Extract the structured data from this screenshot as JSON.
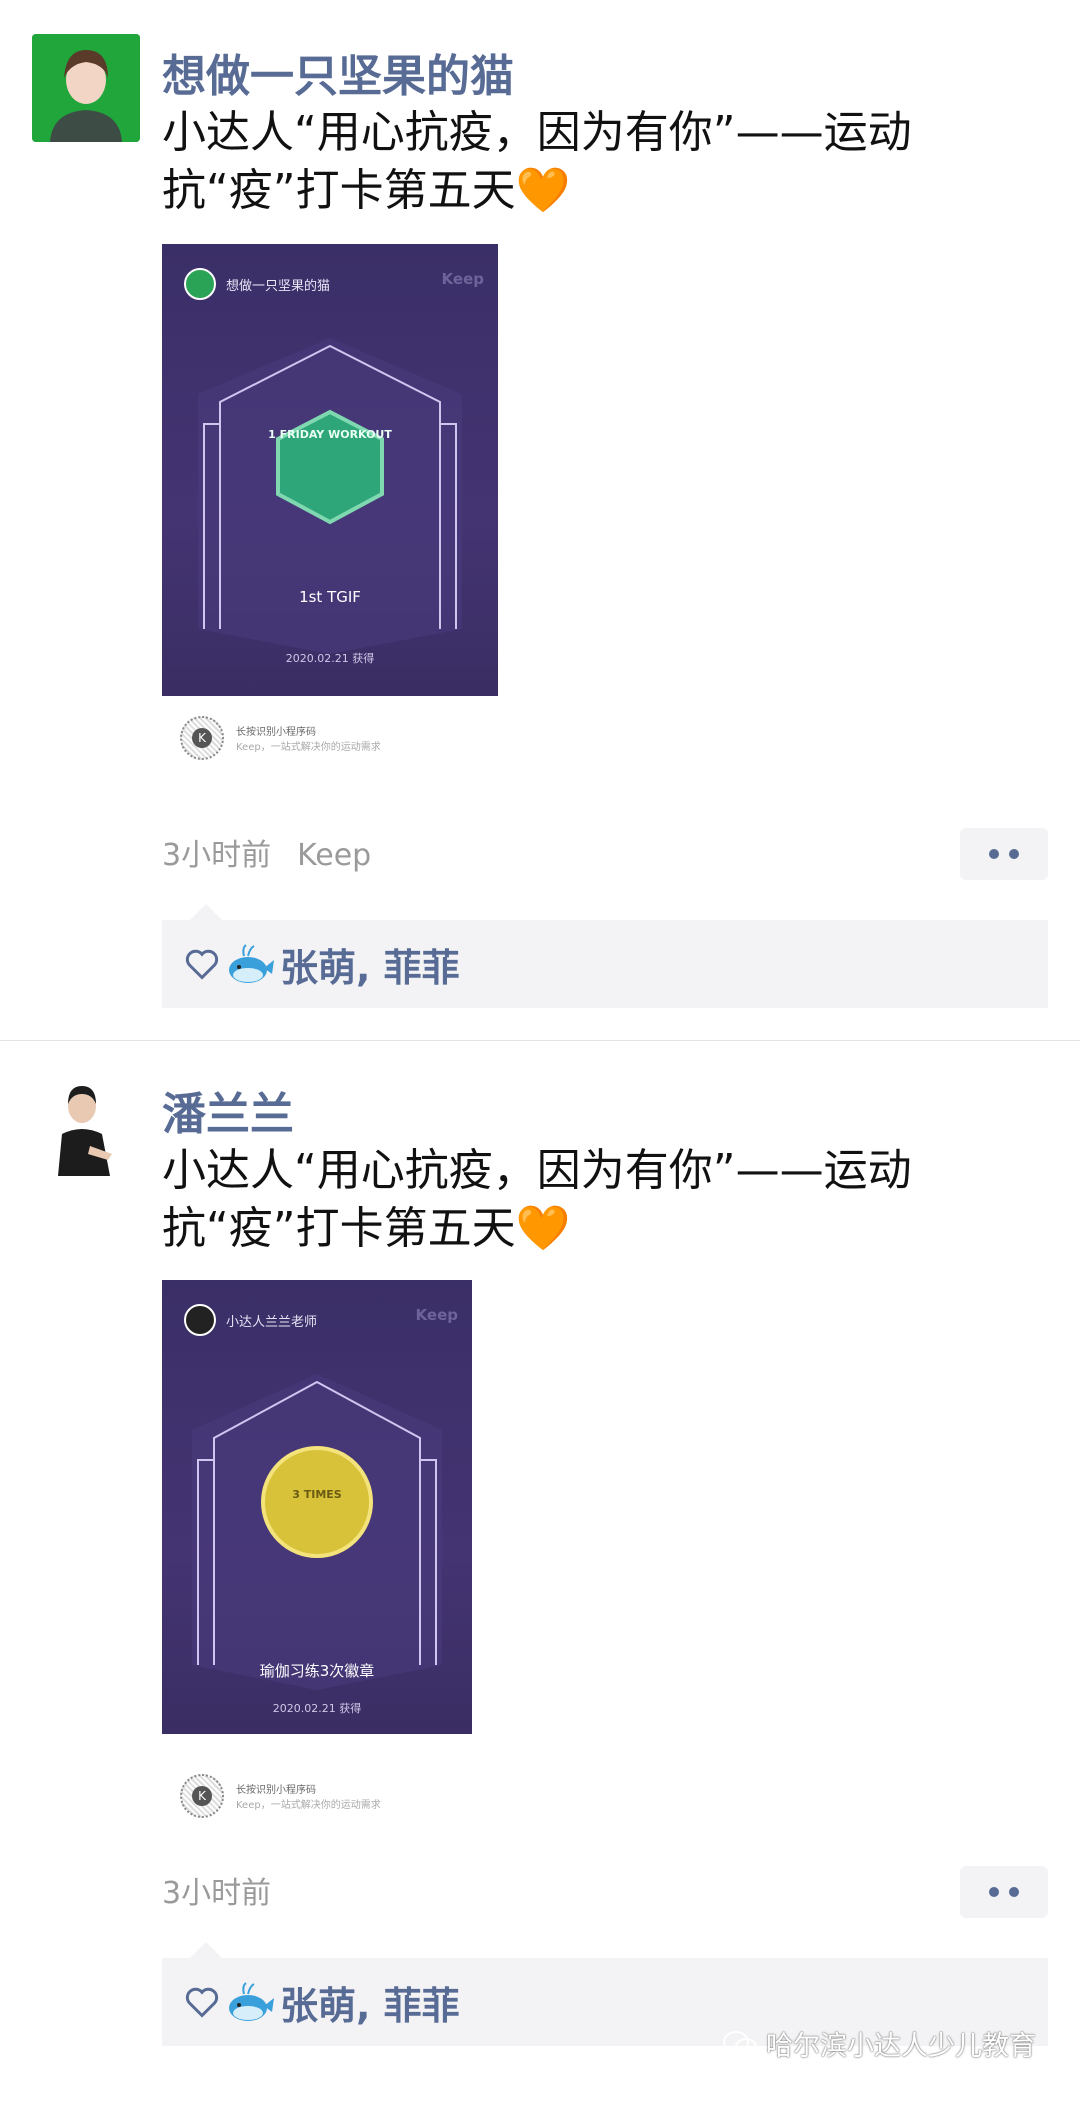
{
  "posts": [
    {
      "username": "想做一只坚果的猫",
      "content": "小达人“用心抗疫，因为有你”——运动抗“疫”打卡第五天",
      "emoji": "🧡",
      "card": {
        "poster_user": "想做一只坚果的猫",
        "brand": "Keep",
        "badge_title": "1st TGIF",
        "badge_date": "2020.02.21 获得",
        "badge_icon_text": "1 FRIDAY WORKOUT",
        "qr_line1": "长按识别小程序码",
        "qr_line2": "Keep，一站式解决你的运动需求"
      },
      "time": "3小时前",
      "source": "Keep",
      "likes": "张萌, 菲菲"
    },
    {
      "username": "潘兰兰",
      "content": "小达人“用心抗疫，因为有你”——运动抗“疫”打卡第五天",
      "emoji": "🧡",
      "card": {
        "poster_user": "小达人兰兰老师",
        "brand": "Keep",
        "badge_title": "瑜伽习练3次徽章",
        "badge_date": "2020.02.21 获得",
        "badge_icon_text": "3 TIMES",
        "qr_line1": "长按识别小程序码",
        "qr_line2": "Keep，一站式解决你的运动需求"
      },
      "time": "3小时前",
      "source": "",
      "likes": "张萌, 菲菲"
    }
  ],
  "watermark": "哈尔滨小达人少儿教育",
  "colors": {
    "name_blue": "#576b95",
    "poster_purple": "#3b2f68",
    "badge_green": "#2ea67a",
    "badge_gold": "#d8c23a",
    "likes_bg": "#f3f3f5"
  }
}
